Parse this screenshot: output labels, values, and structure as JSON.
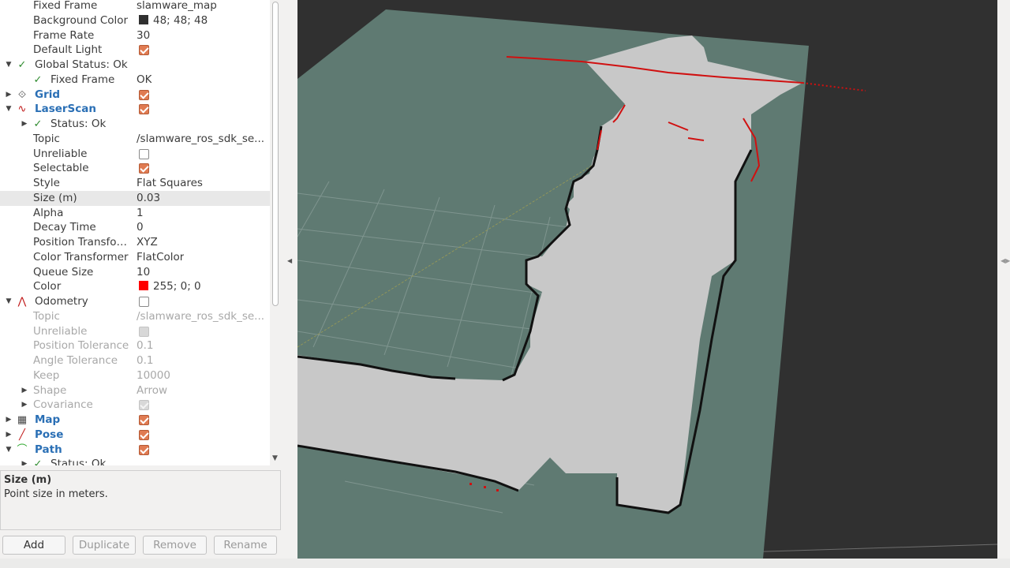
{
  "tree": {
    "rows": [
      {
        "label": "Fixed Frame",
        "value": "slamware_map",
        "indent": 42
      },
      {
        "label": "Background Color",
        "value": "48; 48; 48",
        "indent": 42,
        "swatch": "#303030"
      },
      {
        "label": "Frame Rate",
        "value": "30",
        "indent": 42
      },
      {
        "label": "Default Light",
        "indent": 42,
        "check": true
      },
      {
        "label": "Global Status: Ok",
        "indent": 44,
        "arrow": "down",
        "arrowX": 8,
        "icon": "check",
        "iconX": 22
      },
      {
        "label": "Fixed Frame",
        "value": "OK",
        "indent": 64,
        "icon": "check",
        "iconX": 42
      },
      {
        "label": "Grid",
        "indent": 44,
        "arrow": "right",
        "arrowX": 8,
        "icon": "grid",
        "iconX": 22,
        "display": true,
        "check": true
      },
      {
        "label": "LaserScan",
        "indent": 44,
        "arrow": "down",
        "arrowX": 8,
        "icon": "laser",
        "iconX": 22,
        "display": true,
        "check": true
      },
      {
        "label": "Status: Ok",
        "indent": 64,
        "arrow": "right",
        "arrowX": 28,
        "icon": "check",
        "iconX": 42
      },
      {
        "label": "Topic",
        "value": "/slamware_ros_sdk_se...",
        "indent": 42
      },
      {
        "label": "Unreliable",
        "indent": 42,
        "check": false
      },
      {
        "label": "Selectable",
        "indent": 42,
        "check": true
      },
      {
        "label": "Style",
        "value": "Flat Squares",
        "indent": 42
      },
      {
        "label": "Size (m)",
        "value": "0.03",
        "indent": 42,
        "selected": true
      },
      {
        "label": "Alpha",
        "value": "1",
        "indent": 42
      },
      {
        "label": "Decay Time",
        "value": "0",
        "indent": 42
      },
      {
        "label": "Position Transfo…",
        "value": "XYZ",
        "indent": 42
      },
      {
        "label": "Color Transformer",
        "value": "FlatColor",
        "indent": 42
      },
      {
        "label": "Queue Size",
        "value": "10",
        "indent": 42
      },
      {
        "label": "Color",
        "value": "255; 0; 0",
        "indent": 42,
        "swatch": "#ff0000"
      },
      {
        "label": "Odometry",
        "indent": 44,
        "arrow": "down",
        "arrowX": 8,
        "icon": "odom",
        "iconX": 22,
        "check": false
      },
      {
        "label": "Topic",
        "value": "/slamware_ros_sdk_se...",
        "indent": 42,
        "disabled": true
      },
      {
        "label": "Unreliable",
        "indent": 42,
        "check": false,
        "disabled": true
      },
      {
        "label": "Position Tolerance",
        "value": "0.1",
        "indent": 42,
        "disabled": true
      },
      {
        "label": "Angle Tolerance",
        "value": "0.1",
        "indent": 42,
        "disabled": true
      },
      {
        "label": "Keep",
        "value": "10000",
        "indent": 42,
        "disabled": true
      },
      {
        "label": "Shape",
        "value": "Arrow",
        "indent": 42,
        "arrow": "right",
        "arrowX": 28,
        "disabled": true
      },
      {
        "label": "Covariance",
        "indent": 42,
        "arrow": "right",
        "arrowX": 28,
        "check": true,
        "disabled": true
      },
      {
        "label": "Map",
        "indent": 44,
        "arrow": "right",
        "arrowX": 8,
        "icon": "map",
        "iconX": 22,
        "display": true,
        "check": true
      },
      {
        "label": "Pose",
        "indent": 44,
        "arrow": "right",
        "arrowX": 8,
        "icon": "pose",
        "iconX": 22,
        "display": true,
        "check": true
      },
      {
        "label": "Path",
        "indent": 44,
        "arrow": "down",
        "arrowX": 8,
        "icon": "path",
        "iconX": 22,
        "display": true,
        "check": true
      },
      {
        "label": "Status: Ok",
        "indent": 64,
        "arrow": "right",
        "arrowX": 28,
        "icon": "check",
        "iconX": 42
      }
    ]
  },
  "description": {
    "title": "Size (m)",
    "text": "Point size in meters."
  },
  "buttons": {
    "add": "Add",
    "duplicate": "Duplicate",
    "remove": "Remove",
    "rename": "Rename"
  },
  "colors": {
    "background": "#303030",
    "ground_plane": "#5f7a72",
    "free_space": "#c8c8c8",
    "laser": "#ff0000",
    "accent_check": "#e07b52"
  }
}
